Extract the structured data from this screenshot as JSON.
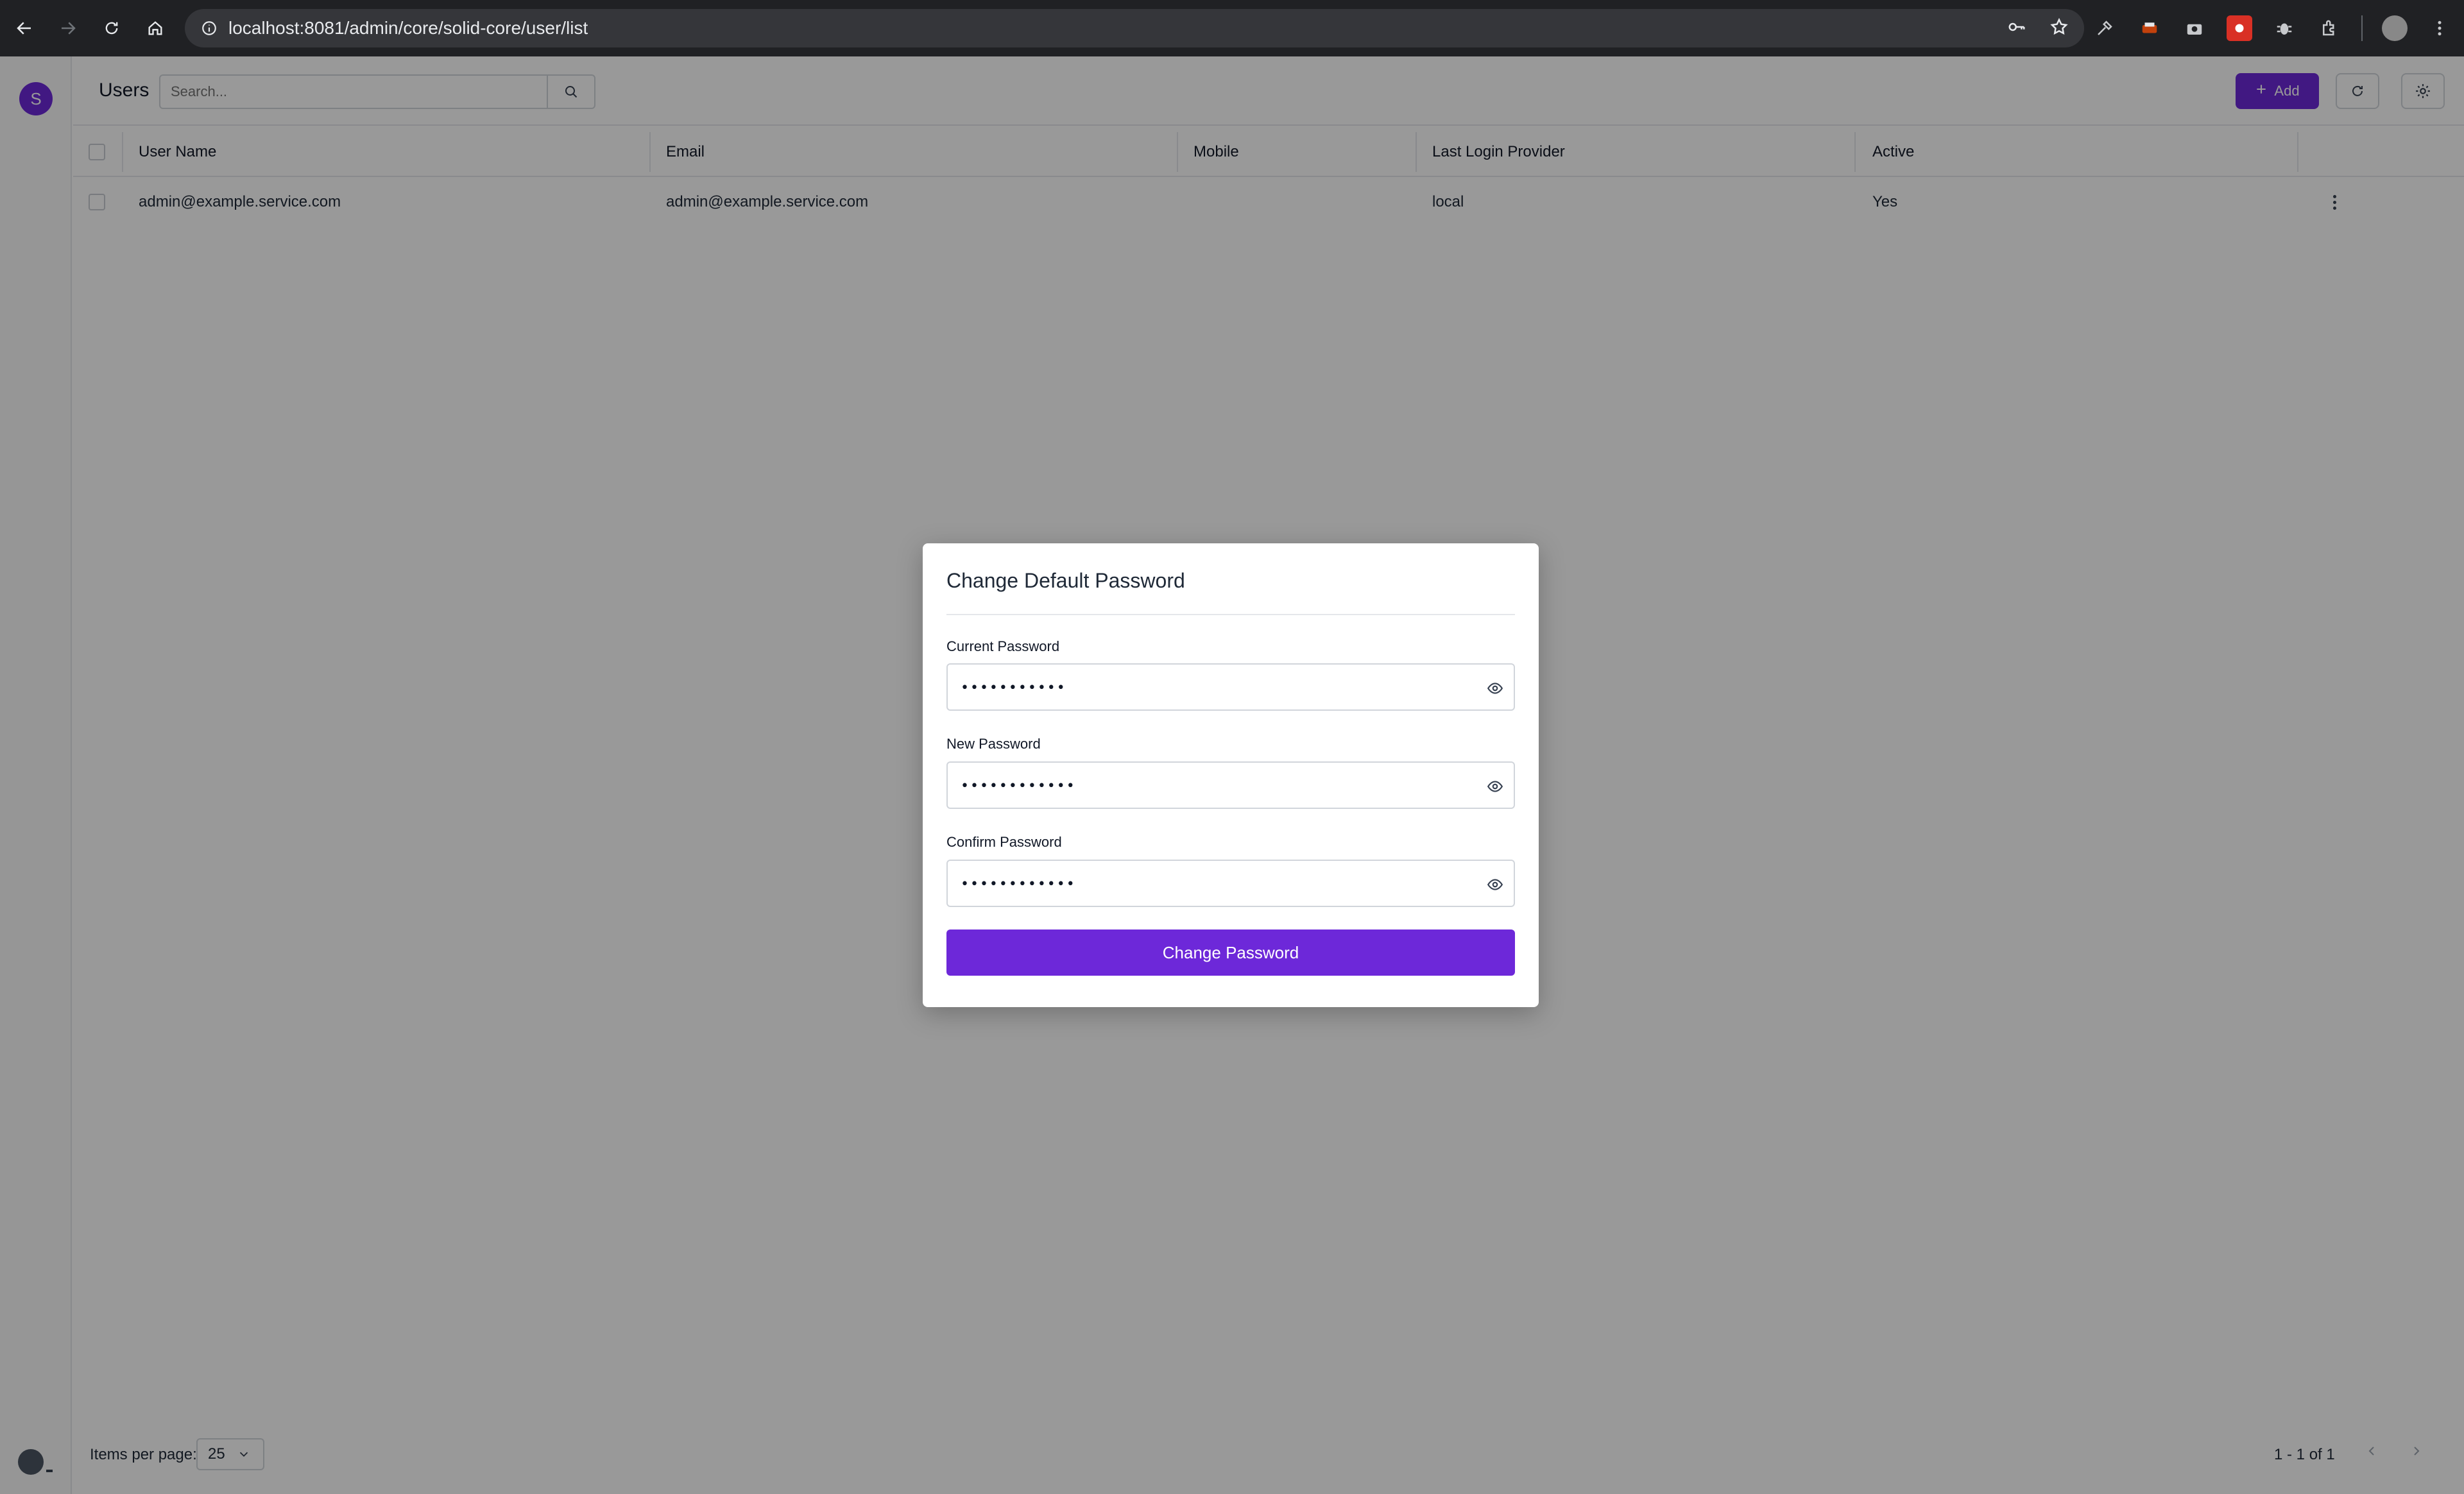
{
  "browser": {
    "url": "localhost:8081/admin/core/solid-core/user/list"
  },
  "app": {
    "logo_letter": "S",
    "page_title": "Users",
    "search": {
      "placeholder": "Search...",
      "value": ""
    },
    "add_label": "Add",
    "accent_color": "#6d28d9"
  },
  "table": {
    "headers": [
      "User Name",
      "Email",
      "Mobile",
      "Last Login Provider",
      "Active"
    ],
    "rows": [
      {
        "user_name": "admin@example.service.com",
        "email": "admin@example.service.com",
        "mobile": "",
        "provider": "local",
        "active": "Yes"
      }
    ]
  },
  "footer": {
    "items_per_page_label": "Items per page:",
    "items_per_page": "25",
    "range": "1 - 1 of 1"
  },
  "dialog": {
    "title": "Change Default Password",
    "fields": [
      {
        "label": "Current Password",
        "masked": "•••••••••••"
      },
      {
        "label": "New Password",
        "masked": "••••••••••••"
      },
      {
        "label": "Confirm Password",
        "masked": "••••••••••••"
      }
    ],
    "submit_label": "Change Password"
  }
}
